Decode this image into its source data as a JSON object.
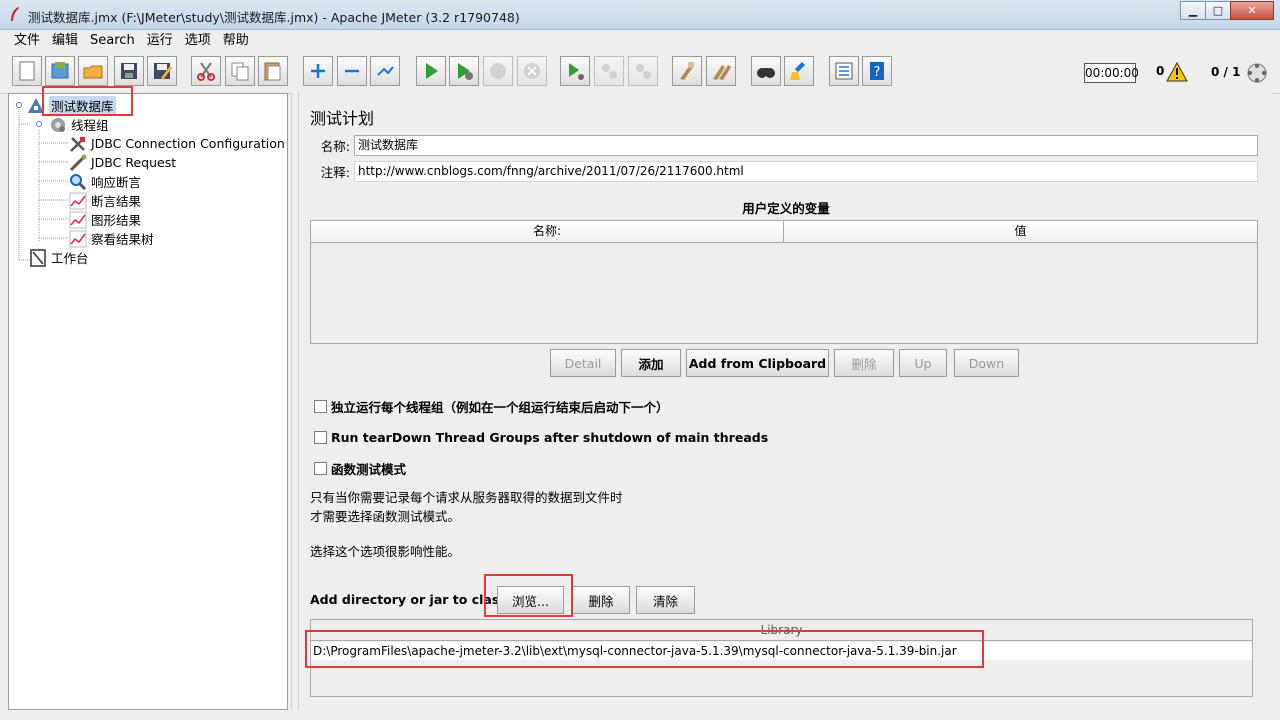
{
  "window": {
    "title": "测试数据库.jmx (F:\\JMeter\\study\\测试数据库.jmx) - Apache JMeter (3.2 r1790748)",
    "controls": [
      "minimize",
      "maximize",
      "close"
    ]
  },
  "menu": [
    "文件",
    "编辑",
    "Search",
    "运行",
    "选项",
    "帮助"
  ],
  "toolbar": {
    "buttons": [
      "new-icon",
      "templates-icon",
      "open-icon",
      "save-icon",
      "save-as-icon",
      "cut-icon",
      "copy-icon",
      "paste-icon",
      "expand-icon",
      "collapse-icon",
      "toggle-icon",
      "start-icon",
      "start-no-pause-icon",
      "stop-icon",
      "shutdown-icon",
      "remote-start-icon",
      "remote-stop-icon",
      "remote-shutdown-icon",
      "clear-icon",
      "clear-all-icon",
      "search-icon",
      "reset-search-icon",
      "function-helper-icon",
      "help-icon"
    ],
    "timer": "00:00:00",
    "error_count": "0",
    "threads": "0 / 1"
  },
  "tree": {
    "items": [
      {
        "label": "测试数据库",
        "icon": "test-plan-icon"
      },
      {
        "label": "线程组",
        "icon": "thread-group-icon"
      },
      {
        "label": "JDBC Connection Configuration",
        "icon": "config-icon"
      },
      {
        "label": "JDBC Request",
        "icon": "sampler-icon"
      },
      {
        "label": "响应断言",
        "icon": "assertion-icon"
      },
      {
        "label": "断言结果",
        "icon": "listener-icon"
      },
      {
        "label": "图形结果",
        "icon": "listener-icon"
      },
      {
        "label": "察看结果树",
        "icon": "listener-icon"
      },
      {
        "label": "工作台",
        "icon": "workbench-icon"
      }
    ]
  },
  "main": {
    "title": "测试计划",
    "name_label": "名称:",
    "name_value": "测试数据库",
    "comment_label": "注释:",
    "comment_value": "http://www.cnblogs.com/fnng/archive/2011/07/26/2117600.html",
    "udv_title": "用户定义的变量",
    "udv_columns": [
      "名称:",
      "值"
    ],
    "udv_buttons": {
      "detail": "Detail",
      "add": "添加",
      "add_clipboard": "Add from Clipboard",
      "delete": "删除",
      "up": "Up",
      "down": "Down"
    },
    "options": {
      "serialize": "独立运行每个线程组（例如在一个组运行结束后启动下一个）",
      "teardown": "Run tearDown Thread Groups after shutdown of main threads",
      "functional": "函数测试模式"
    },
    "help_text": {
      "line1": "只有当你需要记录每个请求从服务器取得的数据到文件时",
      "line2": "才需要选择函数测试模式。",
      "line3": "选择这个选项很影响性能。"
    },
    "classpath_label": "Add directory or jar to classpath",
    "classpath_buttons": {
      "browse": "浏览...",
      "delete": "删除",
      "clear": "清除"
    },
    "library_header": "Library",
    "library_rows": [
      "D:\\ProgramFiles\\apache-jmeter-3.2\\lib\\ext\\mysql-connector-java-5.1.39\\mysql-connector-java-5.1.39-bin.jar"
    ]
  }
}
